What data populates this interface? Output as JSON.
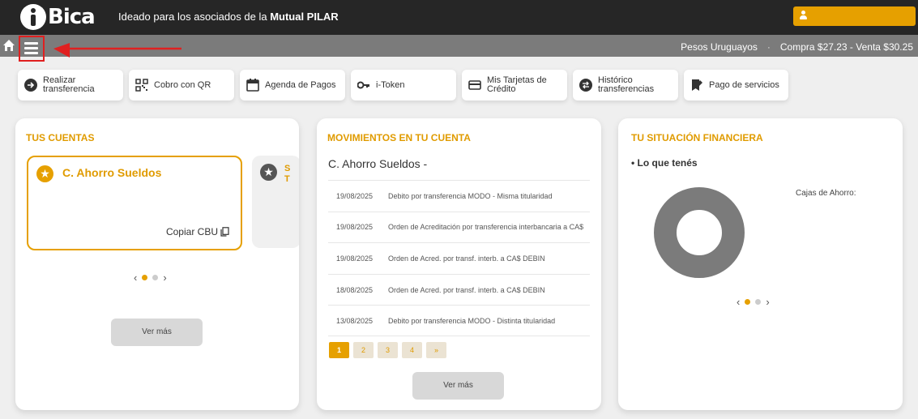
{
  "header": {
    "logo_text": "Bica",
    "tagline_prefix": "Ideado para los asociados de la ",
    "tagline_bold": "Mutual PILAR",
    "user_label": ""
  },
  "subbar": {
    "currency": "Pesos Uruguayos",
    "separator": "·",
    "rates": "Compra $27.23 - Venta $30.25"
  },
  "quick_actions": [
    {
      "label": "Realizar\ntransferencia",
      "icon": "transfer-icon"
    },
    {
      "label": "Cobro con QR",
      "icon": "qr-icon"
    },
    {
      "label": "Agenda de Pagos",
      "icon": "calendar-icon"
    },
    {
      "label": "i-Token",
      "icon": "key-icon"
    },
    {
      "label": "Mis Tarjetas de\nCrédito",
      "icon": "credit-card-icon"
    },
    {
      "label": "Histórico\ntransferencias",
      "icon": "history-icon"
    },
    {
      "label": "Pago de servicios",
      "icon": "receipt-icon"
    }
  ],
  "accounts": {
    "title": "TUS CUENTAS",
    "primary_name": "C. Ahorro Sueldos",
    "copy_cbu": "Copiar CBU",
    "secondary_peek": "S\nT",
    "ver_mas": "Ver más"
  },
  "movements": {
    "title": "MOVIMIENTOS EN TU CUENTA",
    "account": "C. Ahorro Sueldos -",
    "rows": [
      {
        "date": "19/08/2025",
        "text": "Debito por transferencia MODO - Misma titularidad"
      },
      {
        "date": "19/08/2025",
        "text": "Orden de Acreditación por transferencia interbancaria a CA$"
      },
      {
        "date": "19/08/2025",
        "text": "Orden de Acred. por transf. interb. a CA$ DEBIN"
      },
      {
        "date": "18/08/2025",
        "text": "Orden de Acred. por transf. interb. a CA$ DEBIN"
      },
      {
        "date": "13/08/2025",
        "text": "Debito por transferencia MODO - Distinta titularidad"
      }
    ],
    "pages": [
      "1",
      "2",
      "3",
      "4",
      "»"
    ],
    "ver_mas": "Ver más"
  },
  "finance": {
    "title": "TU SITUACIÓN FINANCIERA",
    "subtitle": "• Lo que tenés",
    "legend": "Cajas de Ahorro:"
  },
  "colors": {
    "accent": "#e6a000",
    "header_bg": "#262626",
    "subbar_bg": "#7b7b7b",
    "highlight_red": "#e02020"
  }
}
